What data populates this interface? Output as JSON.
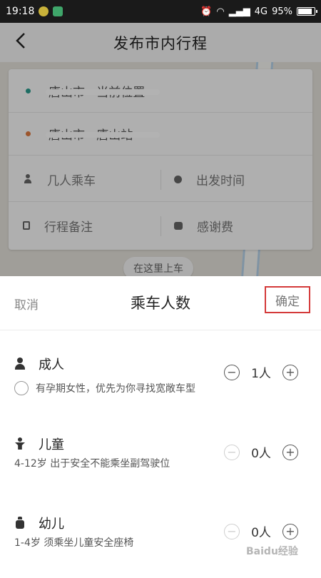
{
  "status_bar": {
    "time": "19:18",
    "network": "4G",
    "battery": "95%",
    "battery_level": 0.95
  },
  "page": {
    "title": "发布市内行程",
    "origin": "唐山市 · 当前位置",
    "destination": "唐山市 · 唐山站",
    "options": {
      "passengers": "几人乘车",
      "depart_time": "出发时间",
      "remark": "行程备注",
      "thanks_fee": "感谢费"
    },
    "map_pin_label": "在这里上车"
  },
  "sheet": {
    "cancel": "取消",
    "title": "乘车人数",
    "confirm": "确定",
    "adult": {
      "label": "成人",
      "count": "1人",
      "pregnant_option": "有孕期女性，优先为你寻找宽敞车型"
    },
    "child": {
      "label": "儿童",
      "count": "0人",
      "desc": "4-12岁 出于安全不能乘坐副驾驶位"
    },
    "infant": {
      "label": "幼儿",
      "count": "0人",
      "desc": "1-4岁 须乘坐儿童安全座椅"
    },
    "minus_symbol": "−",
    "plus_symbol": "+"
  },
  "watermark": "Baidu经验",
  "colors": {
    "origin_dot": "#2a9d8f",
    "dest_dot": "#e07a3f",
    "confirm_border": "#d43a3a"
  }
}
